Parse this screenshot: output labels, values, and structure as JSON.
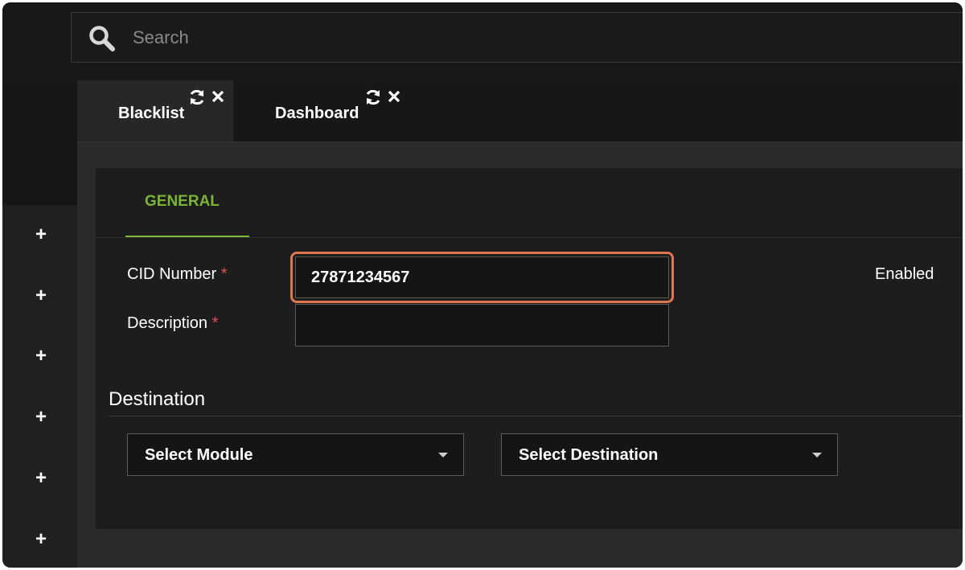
{
  "search": {
    "placeholder": "Search",
    "icon": "search-icon"
  },
  "sidebar": {
    "expand_buttons": [
      "+",
      "+",
      "+",
      "+",
      "+",
      "+"
    ]
  },
  "tabs": [
    {
      "label": "Blacklist",
      "active": true,
      "icons": [
        "refresh-icon",
        "close-icon"
      ]
    },
    {
      "label": "Dashboard",
      "active": false,
      "icons": [
        "refresh-icon",
        "close-icon"
      ]
    }
  ],
  "form": {
    "section_tab": "GENERAL",
    "cid_number": {
      "label": "CID Number",
      "required_mark": "*",
      "value": "27871234567"
    },
    "description": {
      "label": "Description",
      "required_mark": "*",
      "value": ""
    },
    "enabled_label": "Enabled"
  },
  "destination": {
    "title": "Destination",
    "module_select": "Select Module",
    "destination_select": "Select Destination"
  },
  "colors": {
    "accent_green": "#7ab536",
    "focus_orange": "#e0754f",
    "required_red": "#e05050"
  }
}
